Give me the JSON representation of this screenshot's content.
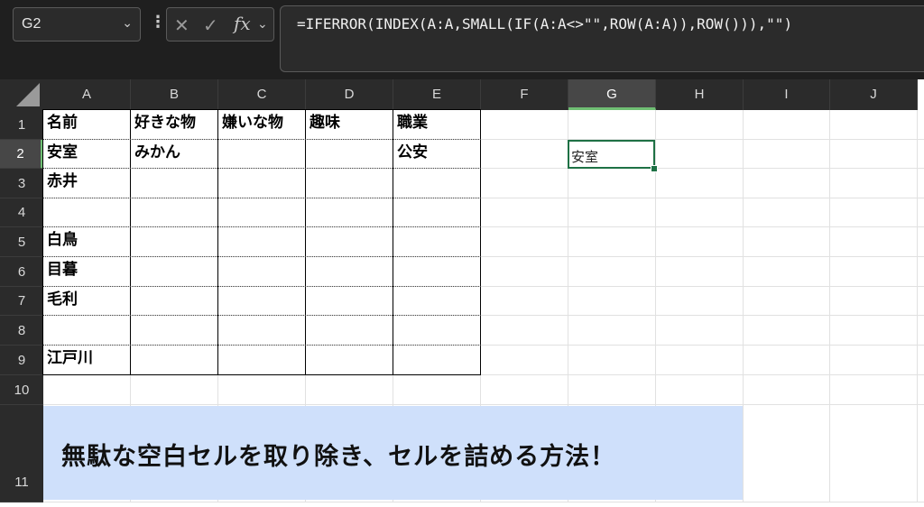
{
  "formula_bar": {
    "name_box": "G2",
    "formula": "=IFERROR(INDEX(A:A,SMALL(IF(A:A<>\"\",ROW(A:A)),ROW())),\"\")",
    "fx_label": "fx"
  },
  "columns": [
    "A",
    "B",
    "C",
    "D",
    "E",
    "F",
    "G",
    "H",
    "I",
    "J"
  ],
  "rows": [
    "1",
    "2",
    "3",
    "4",
    "5",
    "6",
    "7",
    "8",
    "9",
    "10",
    "11"
  ],
  "cells": {
    "A1": "名前",
    "B1": "好きな物",
    "C1": "嫌いな物",
    "D1": "趣味",
    "E1": "職業",
    "A2": "安室",
    "B2": "みかん",
    "E2": "公安",
    "A3": "赤井",
    "A5": "白鳥",
    "A6": "目暮",
    "A7": "毛利",
    "A9": "江戸川",
    "G2": "安室"
  },
  "selected": {
    "column": "G",
    "row": "2"
  },
  "banner": {
    "text": "無駄な空白セルを取り除き、セルを詰める方法！"
  },
  "colors": {
    "selection": "#1e7145",
    "banner": "#cfe0fb",
    "header": "#2b2b2b"
  }
}
